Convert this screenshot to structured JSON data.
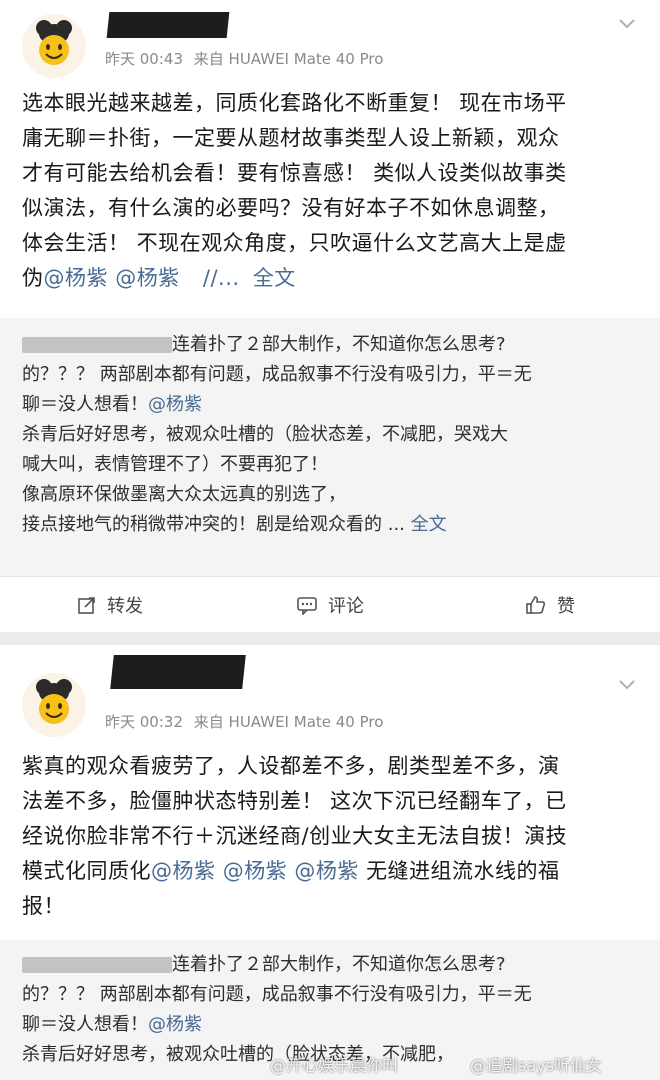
{
  "posts": [
    {
      "time": "昨天 00:43",
      "source": "来自 HUAWEI Mate 40 Pro",
      "body_lines": [
        "选本眼光越来越差，同质化套路化不断重复！ 现在市场平",
        "庸无聊＝扑街，一定要从题材故事类型人设上新颖，观众",
        "才有可能去给机会看！要有惊喜感！ 类似人设类似故事类",
        "似演法，有什么演的必要吗？没有好本子不如休息调整，",
        "体会生活！ 不现在观众角度，只吹逼什么文艺高大上是虚",
        "伪"
      ],
      "mentions": [
        "@杨紫",
        "@杨紫"
      ],
      "separator": "//...",
      "full_text": "全文",
      "quote_lines": [
        "连着扑了２部大制作，不知道你怎么思考?",
        "的？？？ 两部剧本都有问题，成品叙事不行没有吸引力，平＝无",
        "聊＝没人想看！",
        "杀青后好好思考，被观众吐槽的（脸状态差，不减肥，哭戏大",
        "喊大叫，表情管理不了）不要再犯了！",
        "像高原环保做墨离大众太远真的别选了，",
        "接点接地气的稍微带冲突的！剧是给观众看的 ..."
      ],
      "quote_mention": "@杨紫",
      "quote_full_text": "全文",
      "actions": {
        "repost": "转发",
        "comment": "评论",
        "like": "赞"
      }
    },
    {
      "time": "昨天 00:32",
      "source": "来自 HUAWEI Mate 40 Pro",
      "body_lines": [
        "紫真的观众看疲劳了，人设都差不多，剧类型差不多，演",
        "法差不多，脸僵肿状态特别差！ 这次下沉已经翻车了，已",
        "经说你脸非常不行＋沉迷经商/创业大女主无法自拔！演技",
        "模式化同质化",
        "无缝进组流水线的福",
        "报！"
      ],
      "mentions": [
        "@杨紫",
        "@杨紫",
        "@杨紫"
      ],
      "quote_lines": [
        "连着扑了２部大制作，不知道你怎么思考?",
        "的？？？ 两部剧本都有问题，成品叙事不行没有吸引力，平＝无",
        "聊＝没人想看！",
        "杀青后好好思考，被观众吐槽的（脸状态差，不减肥，"
      ],
      "quote_mention": "@杨紫"
    }
  ],
  "watermarks": [
    "@开心娱乐晨你叫",
    "@追剧says听仙女"
  ],
  "colors": {
    "link": "#4a6b94",
    "meta": "#8a8a8a",
    "quote_bg": "#f4f4f4"
  }
}
